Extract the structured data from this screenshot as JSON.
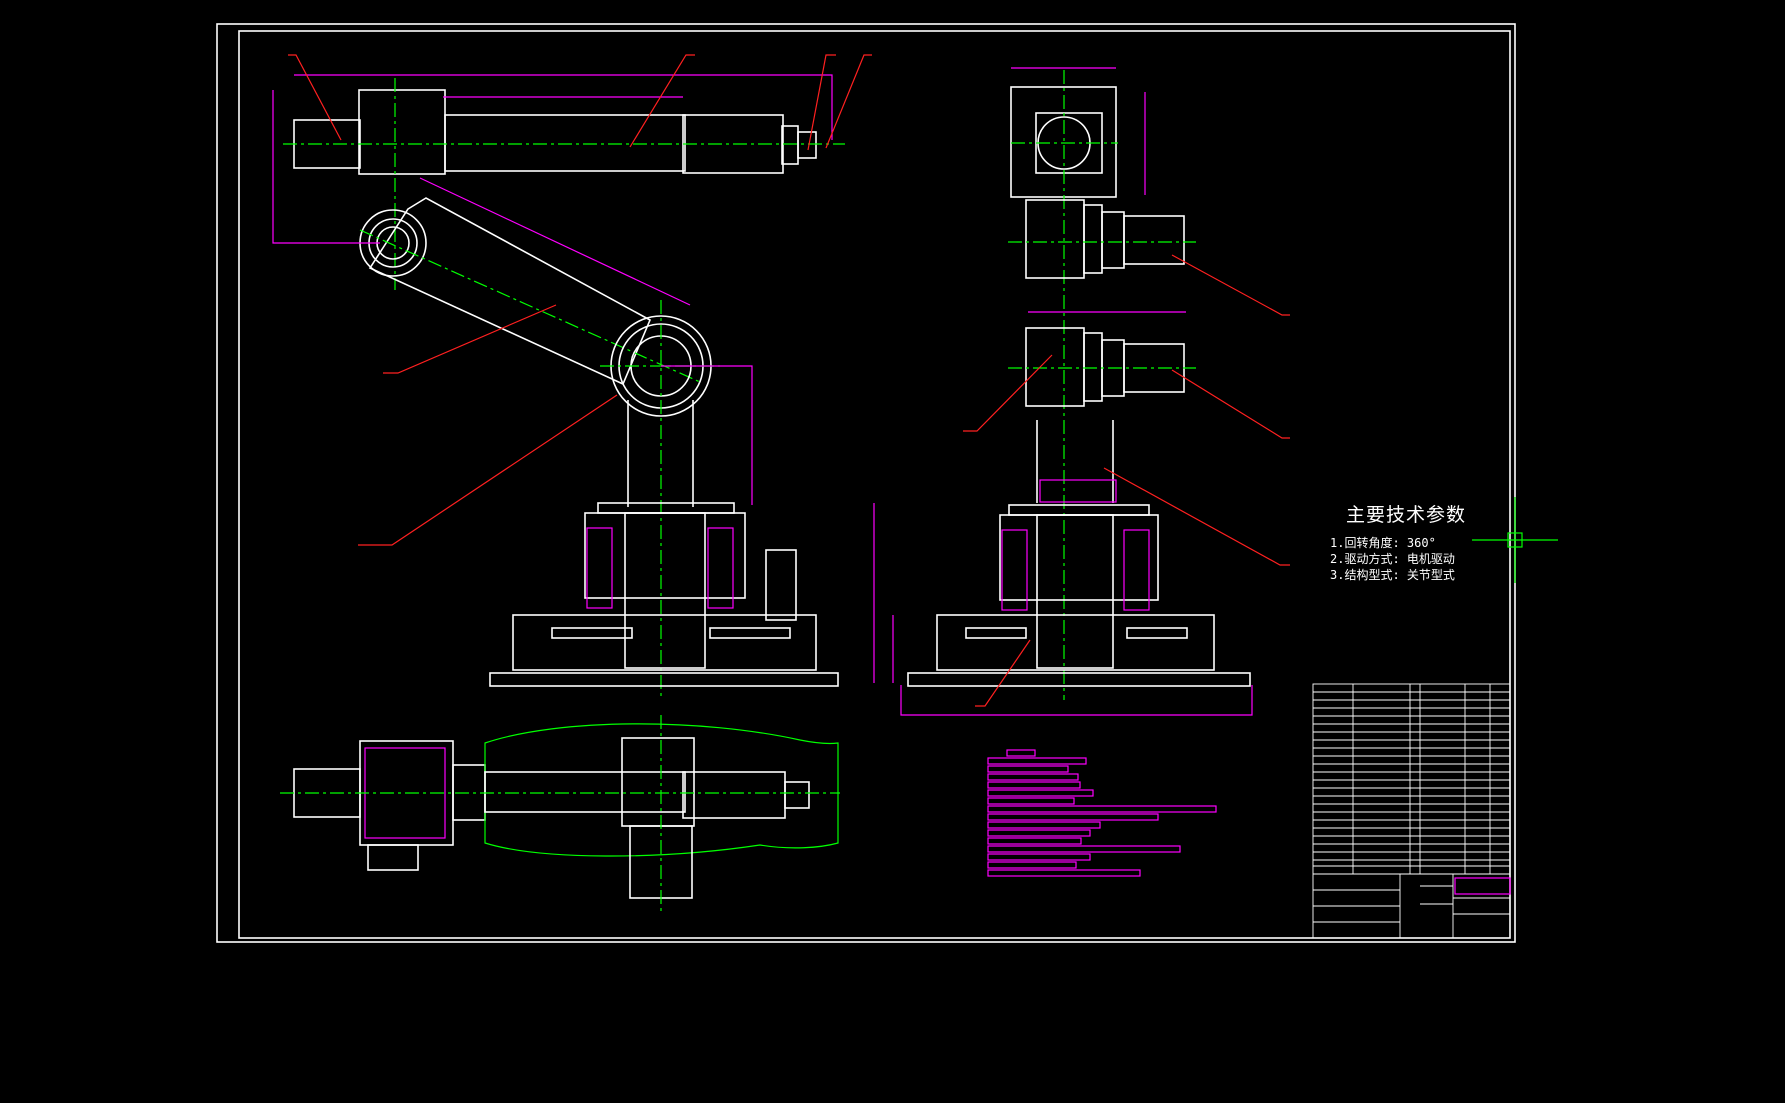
{
  "params": {
    "title": "主要技术参数",
    "items": [
      "1.回转角度: 360°",
      "2.驱动方式: 电机驱动",
      "3.结构型式: 关节型式"
    ]
  },
  "colors": {
    "background": "#000000",
    "outline": "#ffffff",
    "dimension": "#ff00ff",
    "leader": "#ff2020",
    "centerline": "#00ff00"
  }
}
